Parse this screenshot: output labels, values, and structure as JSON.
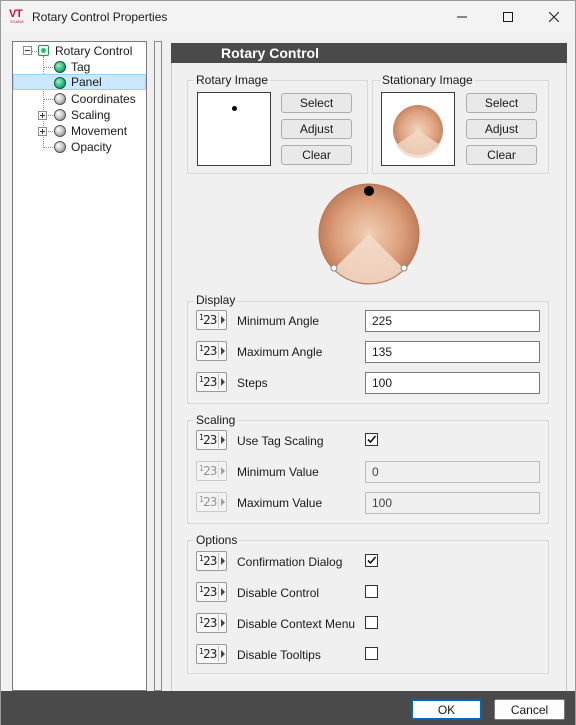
{
  "window": {
    "title": "Rotary Control Properties",
    "logo_text": "VT",
    "logo_subtext": "SCADA",
    "accent_color": "#c8102e"
  },
  "titlebar_buttons": {
    "minimize": "minimize-icon",
    "maximize": "maximize-icon",
    "close": "close-icon"
  },
  "tree": {
    "root": {
      "label": "Rotary Control",
      "icon": "rotary-control-icon",
      "expanded": true
    },
    "items": [
      {
        "label": "Tag",
        "icon": "green-node-icon",
        "expandable": false,
        "selected": false
      },
      {
        "label": "Panel",
        "icon": "green-node-icon",
        "expandable": false,
        "selected": true
      },
      {
        "label": "Coordinates",
        "icon": "gray-node-icon",
        "expandable": false,
        "selected": false
      },
      {
        "label": "Scaling",
        "icon": "gray-node-icon",
        "expandable": true,
        "selected": false
      },
      {
        "label": "Movement",
        "icon": "gray-node-icon",
        "expandable": true,
        "selected": false
      },
      {
        "label": "Opacity",
        "icon": "gray-node-icon",
        "expandable": false,
        "selected": false
      }
    ]
  },
  "header": {
    "title": "Rotary Control"
  },
  "rotary_image": {
    "group_title": "Rotary Image",
    "buttons": {
      "select": "Select",
      "adjust": "Adjust",
      "clear": "Clear"
    }
  },
  "stationary_image": {
    "group_title": "Stationary Image",
    "buttons": {
      "select": "Select",
      "adjust": "Adjust",
      "clear": "Clear"
    }
  },
  "display": {
    "group_title": "Display",
    "rows": [
      {
        "label": "Minimum Angle",
        "value": "225"
      },
      {
        "label": "Maximum Angle",
        "value": "135"
      },
      {
        "label": "Steps",
        "value": "100"
      }
    ]
  },
  "scaling": {
    "group_title": "Scaling",
    "use_tag_scaling": {
      "label": "Use Tag Scaling",
      "checked": true
    },
    "rows": [
      {
        "label": "Minimum Value",
        "value": "0",
        "disabled": true
      },
      {
        "label": "Maximum Value",
        "value": "100",
        "disabled": true
      }
    ]
  },
  "options": {
    "group_title": "Options",
    "rows": [
      {
        "label": "Confirmation Dialog",
        "checked": true
      },
      {
        "label": "Disable Control",
        "checked": false
      },
      {
        "label": "Disable Context Menu",
        "checked": false
      },
      {
        "label": "Disable Tooltips",
        "checked": false
      }
    ]
  },
  "numeric_button_glyph": {
    "base": "1",
    "sup": "2",
    "tail": "3"
  },
  "footer": {
    "ok_label": "OK",
    "cancel_label": "Cancel"
  }
}
